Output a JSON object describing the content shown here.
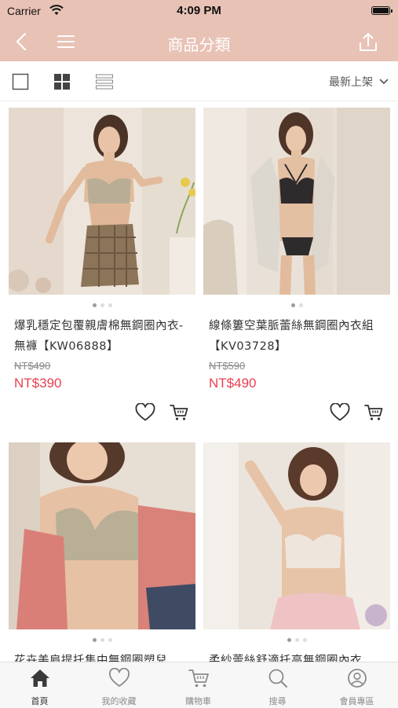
{
  "status": {
    "carrier": "Carrier",
    "time": "4:09 PM"
  },
  "nav": {
    "title": "商品分類"
  },
  "toolbar": {
    "sort_label": "最新上架"
  },
  "products": [
    {
      "name": "爆乳穩定包覆親膚棉無鋼圈內衣-無褲【KW06888】",
      "old_price": "NT$490",
      "price": "NT$390"
    },
    {
      "name": "線條簍空葉脈蕾絲無鋼圈內衣組【KV03728】",
      "old_price": "NT$590",
      "price": "NT$490"
    },
    {
      "name": "花卉美肩提托集中無鋼圈塑兒",
      "old_price": "",
      "price": ""
    },
    {
      "name": "柔紗蕾絲舒適托高無鋼圈內衣",
      "old_price": "",
      "price": ""
    }
  ],
  "tabs": [
    {
      "label": "首頁",
      "icon": "home-icon"
    },
    {
      "label": "我的收藏",
      "icon": "heart-icon"
    },
    {
      "label": "購物車",
      "icon": "cart-icon"
    },
    {
      "label": "搜尋",
      "icon": "search-icon"
    },
    {
      "label": "會員專區",
      "icon": "user-icon"
    }
  ],
  "colors": {
    "header": "#e8c2b5",
    "price": "#e8404f",
    "old_price": "#8a8a8a"
  }
}
